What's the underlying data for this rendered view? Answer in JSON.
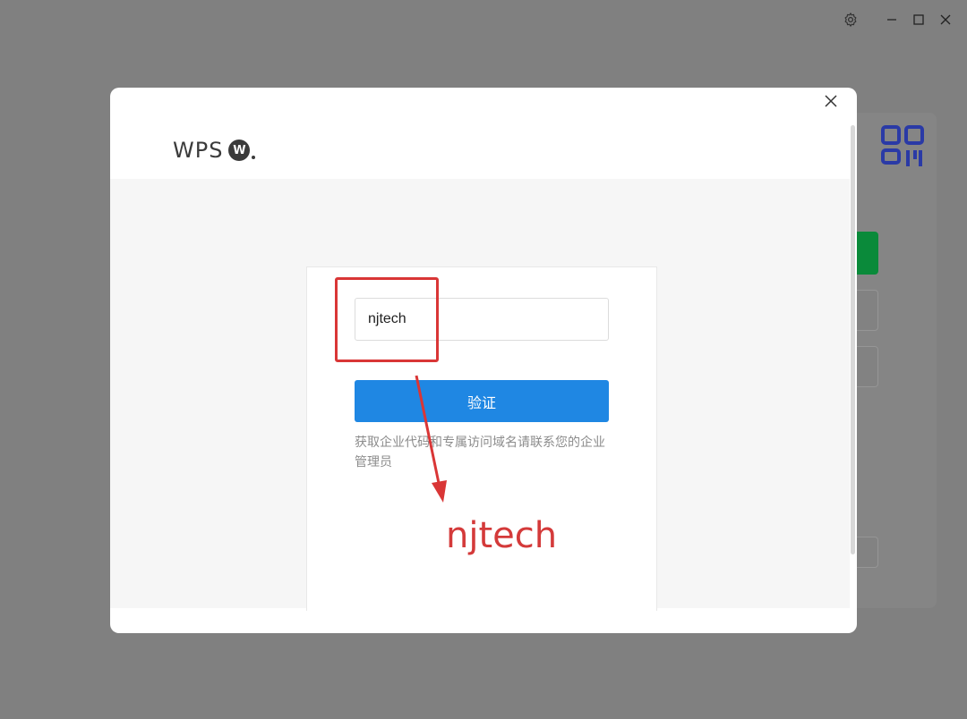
{
  "window": {
    "controls": [
      "settings-icon",
      "minimize-icon",
      "maximize-icon",
      "close-icon"
    ]
  },
  "dialog": {
    "logo": {
      "text": "WPS",
      "badge": "W"
    },
    "close_icon": "close-icon"
  },
  "form": {
    "company_code_value": "njtech",
    "verify_label": "验证",
    "hint": "获取企业代码和专属访问域名请联系您的企业管理员"
  },
  "annotation": {
    "text": "njtech",
    "color": "#d93636"
  },
  "colors": {
    "accent": "#1f87e3",
    "overlay": "#808080"
  }
}
